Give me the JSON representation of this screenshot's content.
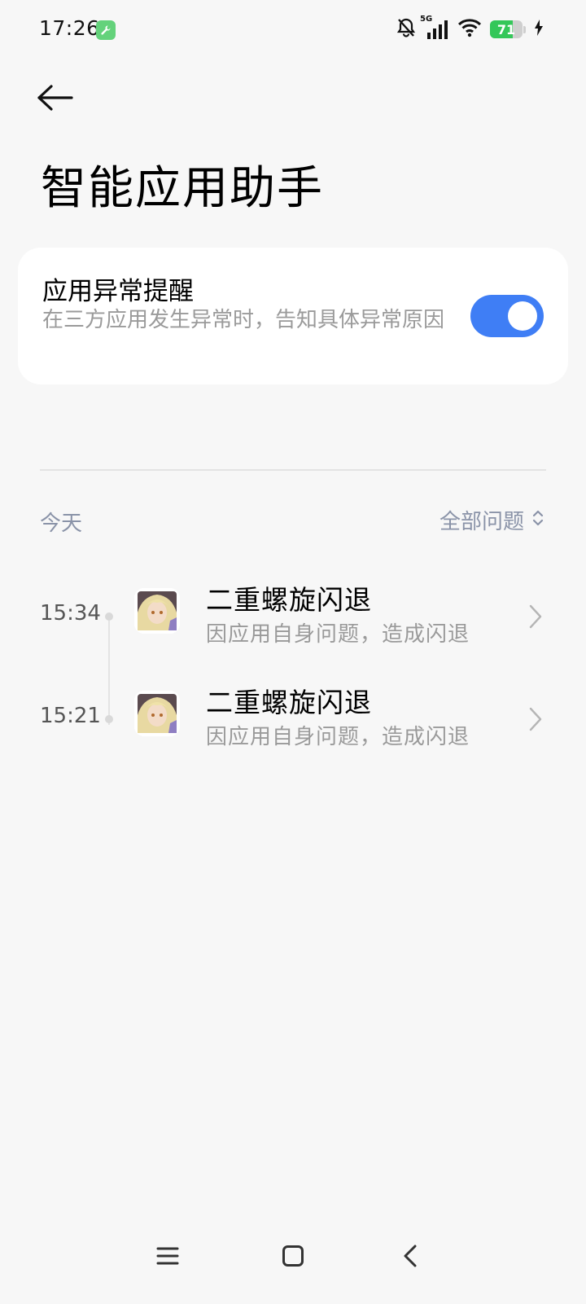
{
  "status_bar": {
    "time": "17:26",
    "network": "5G",
    "battery_level": "71",
    "battery_fraction": 0.71,
    "icons": [
      "wrench-icon",
      "bell-muted-icon",
      "signal-icon",
      "wifi-icon",
      "battery-icon",
      "charging-icon"
    ]
  },
  "header": {
    "back_icon": "arrow-left-icon",
    "title": "智能应用助手"
  },
  "setting": {
    "title": "应用异常提醒",
    "description": "在三方应用发生异常时，告知具体异常原因",
    "toggle_on": true,
    "accent_color": "#3f7ef5"
  },
  "list_header": {
    "date": "今天",
    "filter_label": "全部问题"
  },
  "events": [
    {
      "time": "15:34",
      "title": "二重螺旋闪退",
      "description": "因应用自身问题，造成闪退"
    },
    {
      "time": "15:21",
      "title": "二重螺旋闪退",
      "description": "因应用自身问题，造成闪退"
    }
  ],
  "nav_bar": {
    "icons": [
      "menu-icon",
      "home-icon",
      "back-icon"
    ]
  }
}
